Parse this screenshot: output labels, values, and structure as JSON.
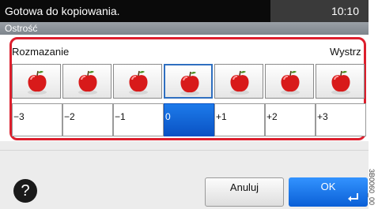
{
  "status": {
    "message": "Gotowa do kopiowania.",
    "time": "10:10"
  },
  "screen": {
    "title": "Ostrość"
  },
  "scale": {
    "left_label": "Rozmazanie",
    "right_label": "Wystrz"
  },
  "levels": [
    {
      "value": "−3",
      "selected": false
    },
    {
      "value": "−2",
      "selected": false
    },
    {
      "value": "−1",
      "selected": false
    },
    {
      "value": "0",
      "selected": true
    },
    {
      "value": "+1",
      "selected": false
    },
    {
      "value": "+2",
      "selected": false
    },
    {
      "value": "+3",
      "selected": false
    }
  ],
  "buttons": {
    "help": "?",
    "cancel": "Anuluj",
    "ok": "OK"
  },
  "side_code": "3B0060_00",
  "colors": {
    "frame": "#dc1f2d",
    "selected": "#0a52c4",
    "ok": "#1a72e8"
  },
  "icons": {
    "apple": "apple-icon",
    "enter": "enter-icon",
    "help": "help-icon"
  }
}
